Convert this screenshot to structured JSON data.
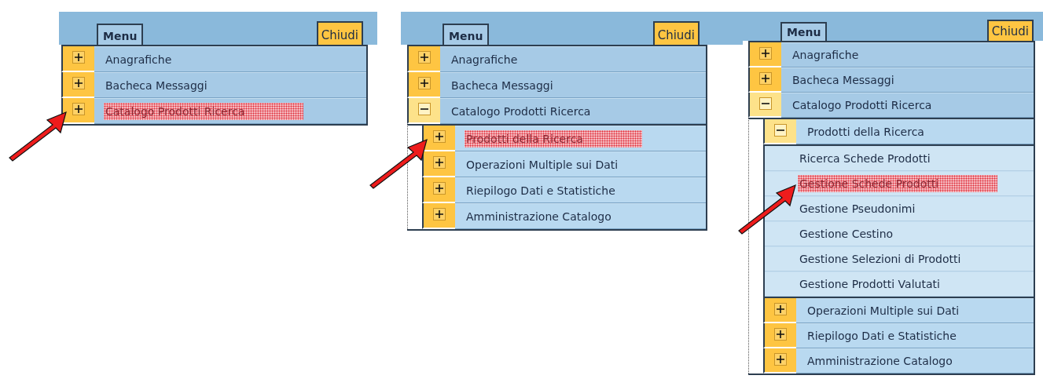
{
  "panels": [
    {
      "tab": "Menu",
      "close": "Chiudi",
      "items": [
        {
          "kind": "folder",
          "label": "Anagrafiche",
          "expanded": false,
          "highlighted": false
        },
        {
          "kind": "folder",
          "label": "Bacheca Messaggi",
          "expanded": false,
          "highlighted": false
        },
        {
          "kind": "folder",
          "label": "Catalogo Prodotti Ricerca",
          "expanded": false,
          "highlighted": true
        }
      ]
    },
    {
      "tab": "Menu",
      "close": "Chiudi",
      "items": [
        {
          "kind": "folder",
          "label": "Anagrafiche",
          "expanded": false,
          "highlighted": false
        },
        {
          "kind": "folder",
          "label": "Bacheca Messaggi",
          "expanded": false,
          "highlighted": false
        },
        {
          "kind": "folder",
          "label": "Catalogo Prodotti Ricerca",
          "expanded": true,
          "highlighted": false,
          "children": [
            {
              "kind": "folder",
              "label": "Prodotti della Ricerca",
              "expanded": false,
              "highlighted": true
            },
            {
              "kind": "folder",
              "label": "Operazioni Multiple sui Dati",
              "expanded": false,
              "highlighted": false
            },
            {
              "kind": "folder",
              "label": "Riepilogo Dati e Statistiche",
              "expanded": false,
              "highlighted": false
            },
            {
              "kind": "folder",
              "label": "Amministrazione Catalogo",
              "expanded": false,
              "highlighted": false
            }
          ]
        }
      ]
    },
    {
      "tab": "Menu",
      "close": "Chiudi",
      "items": [
        {
          "kind": "folder",
          "label": "Anagrafiche",
          "expanded": false,
          "highlighted": false
        },
        {
          "kind": "folder",
          "label": "Bacheca Messaggi",
          "expanded": false,
          "highlighted": false
        },
        {
          "kind": "folder",
          "label": "Catalogo Prodotti Ricerca",
          "expanded": true,
          "highlighted": false,
          "children": [
            {
              "kind": "folder",
              "label": "Prodotti della Ricerca",
              "expanded": true,
              "highlighted": false,
              "children": [
                {
                  "kind": "leaf",
                  "label": "Ricerca Schede Prodotti",
                  "highlighted": false
                },
                {
                  "kind": "leaf",
                  "label": "Gestione Schede Prodotti",
                  "highlighted": true
                },
                {
                  "kind": "leaf",
                  "label": "Gestione Pseudonimi",
                  "highlighted": false
                },
                {
                  "kind": "leaf",
                  "label": "Gestione Cestino",
                  "highlighted": false
                },
                {
                  "kind": "leaf",
                  "label": "Gestione Selezioni di Prodotti",
                  "highlighted": false
                },
                {
                  "kind": "leaf",
                  "label": "Gestione Prodotti Valutati",
                  "highlighted": false
                }
              ]
            },
            {
              "kind": "folder",
              "label": "Operazioni Multiple sui Dati",
              "expanded": false,
              "highlighted": false
            },
            {
              "kind": "folder",
              "label": "Riepilogo Dati e Statistiche",
              "expanded": false,
              "highlighted": false
            },
            {
              "kind": "folder",
              "label": "Amministrazione Catalogo",
              "expanded": false,
              "highlighted": false
            }
          ]
        }
      ]
    }
  ]
}
